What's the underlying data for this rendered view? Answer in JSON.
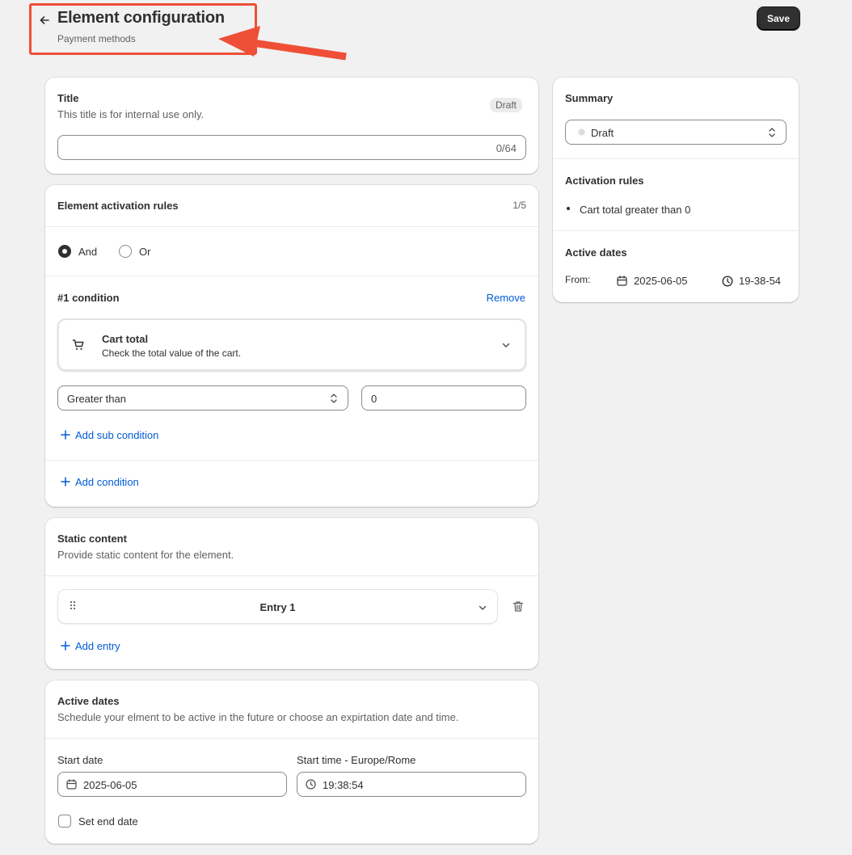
{
  "header": {
    "title": "Element configuration",
    "subtitle": "Payment methods",
    "save_label": "Save"
  },
  "title_card": {
    "heading": "Title",
    "help": "This title is for internal use only.",
    "badge": "Draft",
    "input_value": "",
    "counter": "0/64"
  },
  "rules_card": {
    "heading": "Element activation rules",
    "count": "1/5",
    "logic_options": [
      {
        "label": "And",
        "checked": true
      },
      {
        "label": "Or",
        "checked": false
      }
    ],
    "condition": {
      "heading": "#1 condition",
      "remove_label": "Remove",
      "type_title": "Cart total",
      "type_description": "Check the total value of the cart.",
      "operator": "Greater than",
      "value": "0",
      "add_sub_label": "Add sub condition"
    },
    "add_condition_label": "Add condition"
  },
  "static_card": {
    "heading": "Static content",
    "help": "Provide static content for the element.",
    "entries": [
      "Entry 1"
    ],
    "add_entry_label": "Add entry"
  },
  "dates_card": {
    "heading": "Active dates",
    "help": "Schedule your elment to be active in the future or choose an expirtation date and time.",
    "start_date_label": "Start date",
    "start_date": "2025-06-05",
    "start_time_label": "Start time - Europe/Rome",
    "start_time": "19:38:54",
    "end_date_label": "Set end date",
    "end_date_checked": false
  },
  "summary": {
    "heading": "Summary",
    "status": "Draft",
    "rules_heading": "Activation rules",
    "rules": [
      "Cart total greater than 0"
    ],
    "dates_heading": "Active dates",
    "from_label": "From:",
    "from_date": "2025-06-05",
    "from_time": "19-38-54"
  },
  "colors": {
    "accent_link": "#005bd3",
    "annotation": "#ef4f37",
    "primary_button": "#303030"
  }
}
